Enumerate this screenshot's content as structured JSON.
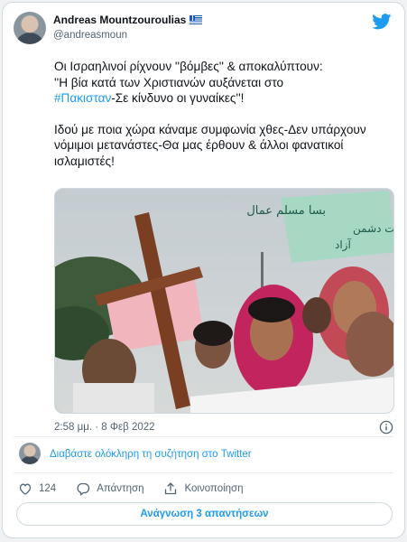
{
  "author": {
    "name": "Andreas Mountzouroulias",
    "handle": "@andreasmoun",
    "flag_icon": "greek-flag"
  },
  "tweet": {
    "paragraph1_before": "Οι Ισραηλινοί ρίχνουν ''βόμβες'' & αποκαλύπτουν:\n''Η βία κατά των Χριστιανών αυξάνεται στο\n",
    "hashtag": "#Πακισταν",
    "paragraph1_after": "-Σε κίνδυνο οι γυναίκες''!",
    "paragraph2": "Ιδού με ποια χώρα κάναμε συμφωνία χθες-Δεν υπάρχουν νόμιμοι μετανάστες-Θα μας έρθουν & άλλοι φανατικοί ισλαμιστές!"
  },
  "photo": {
    "placard_right": "بسا مسلم عمال کو\nکشتی واد\nعورت دشمن\nآزاد"
  },
  "meta": {
    "timestamp": "2:58 μμ. · 8 Φεβ 2022"
  },
  "thread": {
    "link_label": "Διαβάστε ολόκληρη τη συζήτηση στο Twitter"
  },
  "actions": {
    "like_count": "124",
    "reply_label": "Απάντηση",
    "share_label": "Κοινοποίηση"
  },
  "replies_button": {
    "label": "Ανάγνωση 3 απαντήσεων"
  },
  "colors": {
    "accent": "#1d9bf0",
    "text": "#0f1419",
    "muted": "#536471"
  }
}
